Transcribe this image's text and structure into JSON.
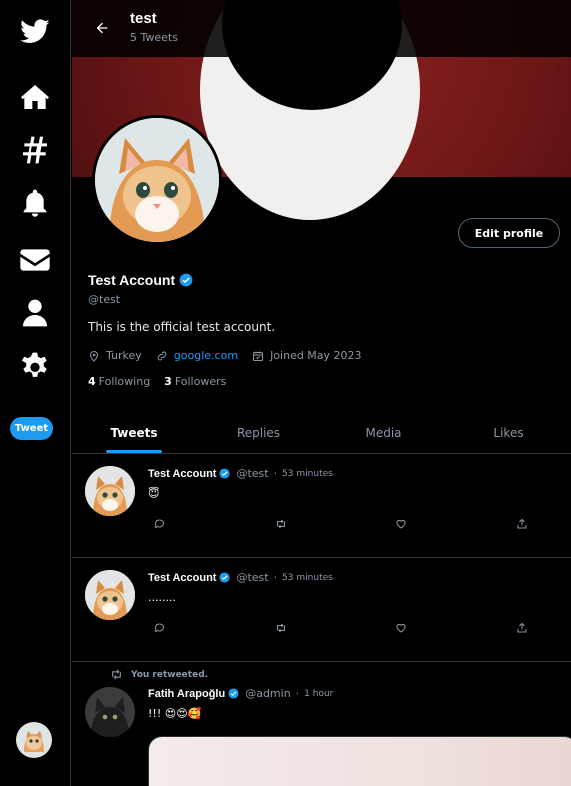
{
  "sidebar": {
    "items": [
      {
        "icon": "twitter-logo-icon"
      },
      {
        "icon": "home-icon"
      },
      {
        "icon": "hashtag-icon"
      },
      {
        "icon": "bell-icon"
      },
      {
        "icon": "envelope-icon"
      },
      {
        "icon": "user-icon"
      },
      {
        "icon": "gear-icon"
      }
    ],
    "tweet_label": "Tweet"
  },
  "header": {
    "title": "test",
    "subtitle": "5 Tweets"
  },
  "profile": {
    "name": "Test Account",
    "handle": "@test",
    "bio": "This is the official test account.",
    "location": "Turkey",
    "website": "google.com",
    "joined": "Joined May 2023",
    "following_count": "4",
    "following_label": "Following",
    "followers_count": "3",
    "followers_label": "Followers",
    "edit_label": "Edit profile"
  },
  "tabs": [
    {
      "label": "Tweets",
      "active": true
    },
    {
      "label": "Replies"
    },
    {
      "label": "Media"
    },
    {
      "label": "Likes"
    }
  ],
  "tweets": [
    {
      "name": "Test Account",
      "handle": "@test",
      "time": "53 minutes",
      "text": "😇"
    },
    {
      "name": "Test Account",
      "handle": "@test",
      "time": "53 minutes",
      "text": "........"
    },
    {
      "retweet_label": "You retweeted.",
      "name": "Fatih Arapoğlu",
      "handle": "@admin",
      "time": "1 hour",
      "text": "!!! 😍😍🥰"
    }
  ],
  "colors": {
    "accent": "#1d9bf0",
    "background": "#000000",
    "muted_text": "#8b98a5",
    "border": "#2f3336"
  }
}
